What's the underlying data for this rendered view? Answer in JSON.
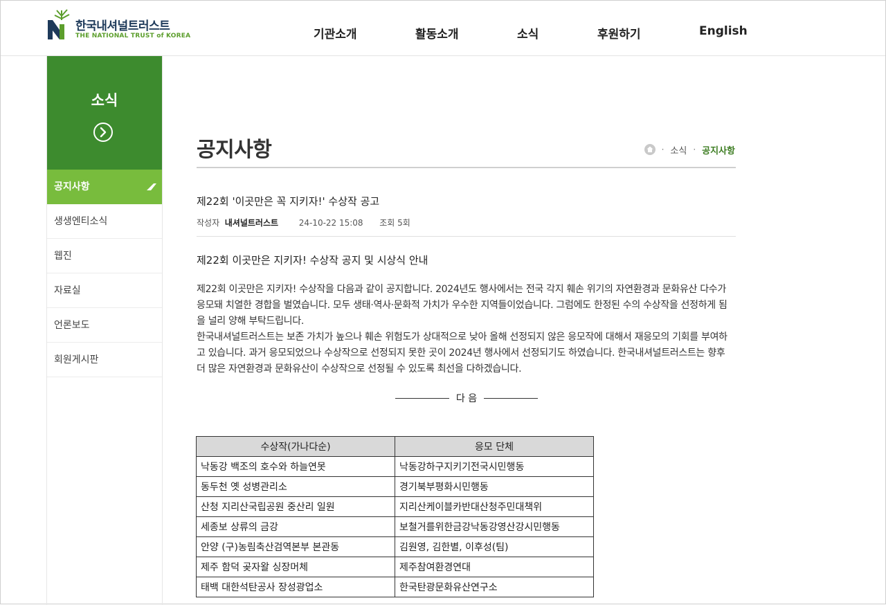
{
  "brand": {
    "name_ko": "한국내셔널트러스트",
    "name_en": "THE NATIONAL TRUST of KOREA",
    "color_green": "#3d8b2e",
    "color_light_green": "#78bc3d",
    "color_navy": "#1e3a5a"
  },
  "gnb": [
    "기관소개",
    "활동소개",
    "소식",
    "후원하기",
    "English"
  ],
  "side": {
    "title": "소식",
    "items": [
      "공지사항",
      "생생엔티소식",
      "웹진",
      "자료실",
      "언론보도",
      "회원게시판"
    ],
    "active_index": 0
  },
  "page": {
    "title": "공지사항",
    "breadcrumb": [
      "소식",
      "공지사항"
    ]
  },
  "post": {
    "title": "제22회 '이곳만은 꼭 지키자!' 수상작 공고",
    "author_label": "작성자",
    "author": "내셔널트러스트",
    "date": "24-10-22 15:08",
    "views": "조회 5회",
    "subheading": "제22회 이곳만은 지키자!  수상작 공지 및 시상식 안내",
    "paragraph1": "제22회 이곳만은 지키자!  수상작을 다음과 같이 공지합니다. 2024년도 행사에서는 전국 각지 훼손 위기의 자연환경과 문화유산 다수가 응모돼 치열한 경합을 벌였습니다.  모두 생태·역사·문화적 가치가 우수한 지역들이었습니다.  그럼에도 한정된 수의 수상작을 선정하게 됨을 널리 양해 부탁드립니다.",
    "paragraph2": "한국내셔널트러스트는 보존 가치가 높으나 훼손 위험도가 상대적으로 낮아 올해 선정되지 않은 응모작에 대해서 재응모의 기회를 부여하고 있습니다.  과거 응모되었으나 수상작으로 선정되지 못한 곳이  2024년 행사에서 선정되기도 하였습니다.  한국내셔널트러스트는 향후 더 많은 자연환경과 문화유산이 수상작으로 선정될 수 있도록 최선을 다하겠습니다.",
    "divider_text": "다 음",
    "table": {
      "headers": [
        "수상작(가나다순)",
        "응모 단체"
      ],
      "rows": [
        [
          "낙동강 백조의 호수와 하늘연못",
          "낙동강하구지키기전국시민행동"
        ],
        [
          "동두천 옛 성병관리소",
          "경기북부평화시민행동"
        ],
        [
          "산청 지리산국립공원 중산리 일원",
          "지리산케이블카반대산청주민대책위"
        ],
        [
          "세종보 상류의 금강",
          "보철거를위한금강낙동강영산강시민행동"
        ],
        [
          "안양 (구)농림축산검역본부 본관동",
          "김원영,  김한별,  이후성(팀)"
        ],
        [
          "제주 함덕 곶자왈 싱장머체",
          "제주참여환경연대"
        ],
        [
          "태백 대한석탄공사 장성광업소",
          "한국탄광문화유산연구소"
        ]
      ]
    }
  }
}
